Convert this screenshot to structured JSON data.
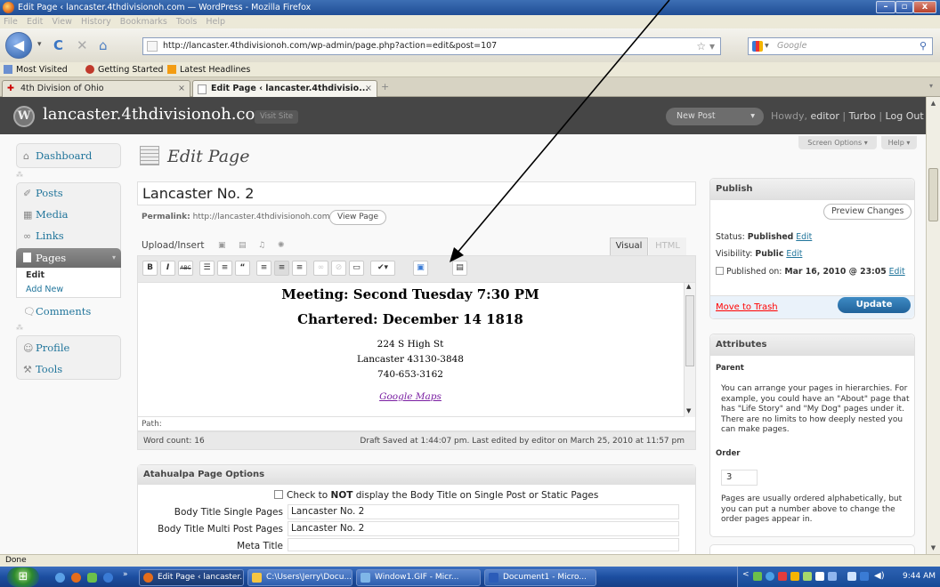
{
  "browser": {
    "window_title": "Edit Page ‹ lancaster.4thdivisionoh.com — WordPress - Mozilla Firefox",
    "menu": [
      "File",
      "Edit",
      "View",
      "History",
      "Bookmarks",
      "Tools",
      "Help"
    ],
    "url": "http://lancaster.4thdivisionoh.com/wp-admin/page.php?action=edit&post=107",
    "search_placeholder": "Google",
    "bookmarks": [
      "Most Visited",
      "Getting Started",
      "Latest Headlines"
    ],
    "tabs": [
      {
        "label": "4th Division of Ohio",
        "active": false
      },
      {
        "label": "Edit Page ‹ lancaster.4thdivisio...",
        "active": true
      }
    ],
    "new_tab": "+",
    "status": "Done"
  },
  "wp_header": {
    "site_name": "lancaster.4thdivisionoh.com",
    "visit_site": "Visit Site",
    "new_post": "New Post",
    "howdy_prefix": "Howdy,",
    "user": "editor",
    "turbo": "Turbo",
    "logout": "Log Out"
  },
  "screen_options": "Screen Options ▾",
  "help": "Help ▾",
  "sidebar": {
    "dashboard": "Dashboard",
    "posts": "Posts",
    "media": "Media",
    "links": "Links",
    "pages": "Pages",
    "pages_sub": [
      "Edit",
      "Add New"
    ],
    "comments": "Comments",
    "profile": "Profile",
    "tools": "Tools"
  },
  "main": {
    "heading": "Edit Page",
    "title_value": "Lancaster No. 2",
    "permalink_label": "Permalink:",
    "permalink_url": "http://lancaster.4thdivisionoh.com",
    "view_page": "View Page",
    "upload_insert": "Upload/Insert",
    "tab_visual": "Visual",
    "tab_html": "HTML"
  },
  "editor": {
    "line1": "Meeting: Second Tuesday 7:30 PM",
    "line2": "Chartered: December 14 1818",
    "addr1": "224 S High St",
    "addr2": "Lancaster 43130-3848",
    "phone": "740-653-3162",
    "map_link": "Google Maps",
    "path_label": "Path:",
    "word_count": "Word count: 16",
    "draft_saved": "Draft Saved at 1:44:07 pm. Last edited by editor on March 25, 2010 at 11:57 pm"
  },
  "atahualpa": {
    "title": "Atahualpa Page Options",
    "checkbox_pre": "Check to",
    "checkbox_bold": "NOT",
    "checkbox_post": "display the Body Title on Single Post or Static Pages",
    "body_title_single_label": "Body Title Single Pages",
    "body_title_single_value": "Lancaster No. 2",
    "body_title_multi_label": "Body Title Multi Post Pages",
    "body_title_multi_value": "Lancaster No. 2",
    "meta_title_label": "Meta Title",
    "meta_title_value": ""
  },
  "publish": {
    "title": "Publish",
    "preview": "Preview Changes",
    "status_label": "Status:",
    "status_value": "Published",
    "visibility_label": "Visibility:",
    "visibility_value": "Public",
    "edit": "Edit",
    "published_on_label": "Published on:",
    "published_on_value": "Mar 16, 2010 @ 23:05",
    "trash": "Move to Trash",
    "update": "Update"
  },
  "attributes": {
    "title": "Attributes",
    "parent_label": "Parent",
    "parent_help": "You can arrange your pages in hierarchies. For example, you could have an \"About\" page that has \"Life Story\" and \"My Dog\" pages under it. There are no limits to how deeply nested you can make pages.",
    "order_label": "Order",
    "order_value": "3",
    "order_help": "Pages are usually ordered alphabetically, but you can put a number above to change the order pages appear in."
  },
  "taskbar": {
    "items": [
      "Edit Page ‹ lancaster...",
      "C:\\Users\\Jerry\\Docu...",
      "Window1.GIF - Micr...",
      "Document1 - Micro..."
    ],
    "overflow": "»",
    "clock": "9:44 AM"
  },
  "colors": {
    "wp_header": "#464646",
    "link": "#21759b",
    "update_button": "#21629a",
    "trash": "#ff0000",
    "taskbar": "#1c4ea0"
  }
}
